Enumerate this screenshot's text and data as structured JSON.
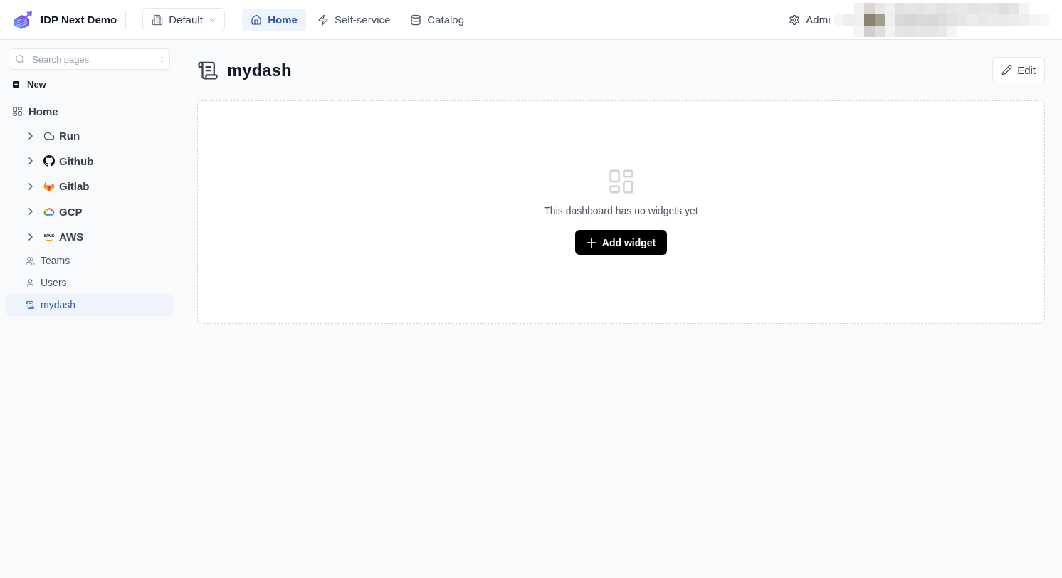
{
  "header": {
    "brand": "IDP Next Demo",
    "workspace": {
      "label": "Default"
    },
    "nav": [
      {
        "label": "Home",
        "selected": true
      },
      {
        "label": "Self-service",
        "selected": false
      },
      {
        "label": "Catalog",
        "selected": false
      }
    ],
    "admin": {
      "label": "Admi"
    }
  },
  "sidebar": {
    "search": {
      "placeholder": "Search pages"
    },
    "new_label": "New",
    "tree": [
      {
        "label": "Home",
        "kind": "root",
        "selected": false,
        "children": [
          {
            "label": "Run",
            "kind": "group",
            "expanded": false,
            "selected": false
          },
          {
            "label": "Github",
            "kind": "group",
            "expanded": false,
            "selected": false
          },
          {
            "label": "Gitlab",
            "kind": "group",
            "expanded": false,
            "selected": false
          },
          {
            "label": "GCP",
            "kind": "group",
            "expanded": false,
            "selected": false
          },
          {
            "label": "AWS",
            "kind": "group",
            "expanded": false,
            "selected": false,
            "logo_text": "aws"
          },
          {
            "label": "Teams",
            "kind": "page",
            "selected": false
          },
          {
            "label": "Users",
            "kind": "page",
            "selected": false
          },
          {
            "label": "mydash",
            "kind": "page",
            "selected": true
          }
        ]
      }
    ]
  },
  "page": {
    "title": "mydash",
    "edit_button": "Edit",
    "empty_state": {
      "message": "This dashboard has no widgets yet",
      "button": "Add widget"
    }
  }
}
